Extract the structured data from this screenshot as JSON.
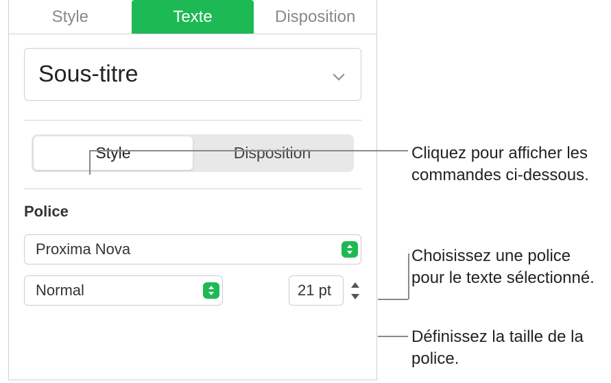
{
  "tabs": {
    "style": "Style",
    "texte": "Texte",
    "disposition": "Disposition"
  },
  "paragraphStyle": {
    "label": "Sous-titre"
  },
  "segmented": {
    "style": "Style",
    "disposition": "Disposition"
  },
  "font": {
    "sectionLabel": "Police",
    "family": "Proxima Nova",
    "weight": "Normal",
    "size": "21 pt"
  },
  "annotations": {
    "segmented": "Cliquez pour afficher les commandes ci-dessous.",
    "fontFamily": "Choisissez une police pour le texte sélectionné.",
    "fontSize": "Définissez la taille de la police."
  }
}
